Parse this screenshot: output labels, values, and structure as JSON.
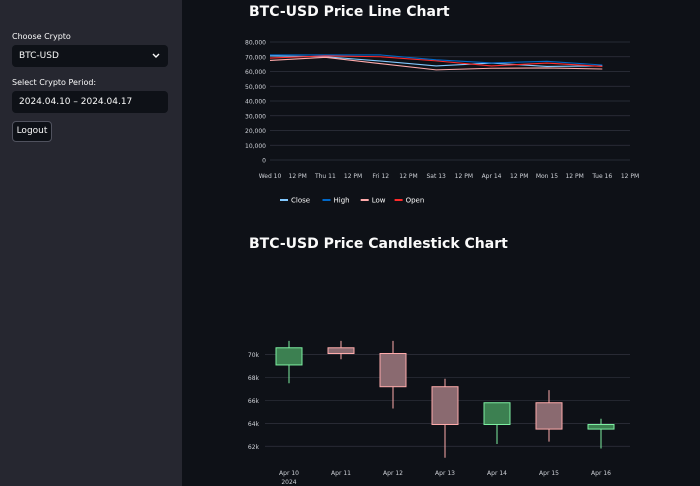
{
  "sidebar": {
    "crypto_label": "Choose Crypto",
    "crypto_value": "BTC-USD",
    "period_label": "Select Crypto Period:",
    "period_value": "2024.04.10 – 2024.04.17",
    "logout_label": "Logout"
  },
  "colors": {
    "close": "#83c9ff",
    "high": "#0068c9",
    "low": "#ffabab",
    "open": "#ff2b2b",
    "candle_up": "#7defa1",
    "candle_down": "#ffabab"
  },
  "chart_data": [
    {
      "type": "line",
      "title": "BTC-USD Price Line Chart",
      "x": [
        "2024-04-10",
        "2024-04-11",
        "2024-04-12",
        "2024-04-13",
        "2024-04-14",
        "2024-04-15",
        "2024-04-16"
      ],
      "x_tick_labels": [
        "Wed 10",
        "12 PM",
        "Thu 11",
        "12 PM",
        "Fri 12",
        "12 PM",
        "Sat 13",
        "12 PM",
        "Apr 14",
        "12 PM",
        "Mon 15",
        "12 PM",
        "Tue 16",
        "12 PM"
      ],
      "y_tick_labels": [
        "0",
        "10,000",
        "20,000",
        "30,000",
        "40,000",
        "50,000",
        "60,000",
        "70,000",
        "80,000"
      ],
      "ylim": [
        0,
        80000
      ],
      "grid": true,
      "legend_position": "bottom",
      "series": [
        {
          "name": "Close",
          "values": [
            70600,
            70000,
            67100,
            63800,
            65700,
            63400,
            63800
          ]
        },
        {
          "name": "High",
          "values": [
            71200,
            71200,
            71200,
            67900,
            65800,
            66900,
            64400
          ]
        },
        {
          "name": "Low",
          "values": [
            67500,
            69600,
            65300,
            61100,
            62200,
            62400,
            61700
          ]
        },
        {
          "name": "Open",
          "values": [
            69100,
            70600,
            70000,
            67200,
            63800,
            65700,
            63400
          ]
        }
      ]
    },
    {
      "type": "candlestick",
      "title": "BTC-USD Price Candlestick Chart",
      "x_tick_labels": [
        "Apr 10",
        "Apr 11",
        "Apr 12",
        "Apr 13",
        "Apr 14",
        "Apr 15",
        "Apr 16"
      ],
      "x_year_label": "2024",
      "y_tick_labels": [
        "62k",
        "64k",
        "66k",
        "68k",
        "70k"
      ],
      "ylim": [
        60800,
        73200
      ],
      "grid": true,
      "candles": [
        {
          "x": "Apr 10",
          "open": 69100,
          "high": 71200,
          "low": 67500,
          "close": 70600
        },
        {
          "x": "Apr 11",
          "open": 70600,
          "high": 71200,
          "low": 69600,
          "close": 70100
        },
        {
          "x": "Apr 12",
          "open": 70100,
          "high": 71200,
          "low": 65300,
          "close": 67200
        },
        {
          "x": "Apr 13",
          "open": 67200,
          "high": 67900,
          "low": 61000,
          "close": 63900
        },
        {
          "x": "Apr 14",
          "open": 63900,
          "high": 65800,
          "low": 62200,
          "close": 65800
        },
        {
          "x": "Apr 15",
          "open": 65800,
          "high": 66900,
          "low": 62400,
          "close": 63500
        },
        {
          "x": "Apr 16",
          "open": 63500,
          "high": 64400,
          "low": 61800,
          "close": 63900
        }
      ]
    }
  ]
}
